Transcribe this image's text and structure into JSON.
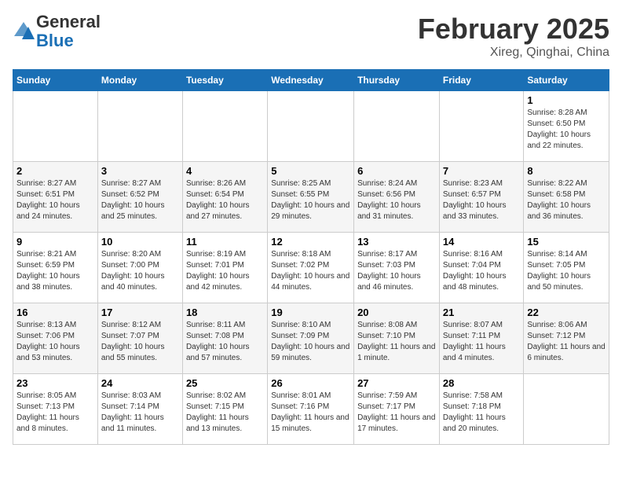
{
  "header": {
    "logo_general": "General",
    "logo_blue": "Blue",
    "month_title": "February 2025",
    "subtitle": "Xireg, Qinghai, China"
  },
  "weekdays": [
    "Sunday",
    "Monday",
    "Tuesday",
    "Wednesday",
    "Thursday",
    "Friday",
    "Saturday"
  ],
  "weeks": [
    [
      {
        "day": "",
        "info": ""
      },
      {
        "day": "",
        "info": ""
      },
      {
        "day": "",
        "info": ""
      },
      {
        "day": "",
        "info": ""
      },
      {
        "day": "",
        "info": ""
      },
      {
        "day": "",
        "info": ""
      },
      {
        "day": "1",
        "info": "Sunrise: 8:28 AM\nSunset: 6:50 PM\nDaylight: 10 hours and 22 minutes."
      }
    ],
    [
      {
        "day": "2",
        "info": "Sunrise: 8:27 AM\nSunset: 6:51 PM\nDaylight: 10 hours and 24 minutes."
      },
      {
        "day": "3",
        "info": "Sunrise: 8:27 AM\nSunset: 6:52 PM\nDaylight: 10 hours and 25 minutes."
      },
      {
        "day": "4",
        "info": "Sunrise: 8:26 AM\nSunset: 6:54 PM\nDaylight: 10 hours and 27 minutes."
      },
      {
        "day": "5",
        "info": "Sunrise: 8:25 AM\nSunset: 6:55 PM\nDaylight: 10 hours and 29 minutes."
      },
      {
        "day": "6",
        "info": "Sunrise: 8:24 AM\nSunset: 6:56 PM\nDaylight: 10 hours and 31 minutes."
      },
      {
        "day": "7",
        "info": "Sunrise: 8:23 AM\nSunset: 6:57 PM\nDaylight: 10 hours and 33 minutes."
      },
      {
        "day": "8",
        "info": "Sunrise: 8:22 AM\nSunset: 6:58 PM\nDaylight: 10 hours and 36 minutes."
      }
    ],
    [
      {
        "day": "9",
        "info": "Sunrise: 8:21 AM\nSunset: 6:59 PM\nDaylight: 10 hours and 38 minutes."
      },
      {
        "day": "10",
        "info": "Sunrise: 8:20 AM\nSunset: 7:00 PM\nDaylight: 10 hours and 40 minutes."
      },
      {
        "day": "11",
        "info": "Sunrise: 8:19 AM\nSunset: 7:01 PM\nDaylight: 10 hours and 42 minutes."
      },
      {
        "day": "12",
        "info": "Sunrise: 8:18 AM\nSunset: 7:02 PM\nDaylight: 10 hours and 44 minutes."
      },
      {
        "day": "13",
        "info": "Sunrise: 8:17 AM\nSunset: 7:03 PM\nDaylight: 10 hours and 46 minutes."
      },
      {
        "day": "14",
        "info": "Sunrise: 8:16 AM\nSunset: 7:04 PM\nDaylight: 10 hours and 48 minutes."
      },
      {
        "day": "15",
        "info": "Sunrise: 8:14 AM\nSunset: 7:05 PM\nDaylight: 10 hours and 50 minutes."
      }
    ],
    [
      {
        "day": "16",
        "info": "Sunrise: 8:13 AM\nSunset: 7:06 PM\nDaylight: 10 hours and 53 minutes."
      },
      {
        "day": "17",
        "info": "Sunrise: 8:12 AM\nSunset: 7:07 PM\nDaylight: 10 hours and 55 minutes."
      },
      {
        "day": "18",
        "info": "Sunrise: 8:11 AM\nSunset: 7:08 PM\nDaylight: 10 hours and 57 minutes."
      },
      {
        "day": "19",
        "info": "Sunrise: 8:10 AM\nSunset: 7:09 PM\nDaylight: 10 hours and 59 minutes."
      },
      {
        "day": "20",
        "info": "Sunrise: 8:08 AM\nSunset: 7:10 PM\nDaylight: 11 hours and 1 minute."
      },
      {
        "day": "21",
        "info": "Sunrise: 8:07 AM\nSunset: 7:11 PM\nDaylight: 11 hours and 4 minutes."
      },
      {
        "day": "22",
        "info": "Sunrise: 8:06 AM\nSunset: 7:12 PM\nDaylight: 11 hours and 6 minutes."
      }
    ],
    [
      {
        "day": "23",
        "info": "Sunrise: 8:05 AM\nSunset: 7:13 PM\nDaylight: 11 hours and 8 minutes."
      },
      {
        "day": "24",
        "info": "Sunrise: 8:03 AM\nSunset: 7:14 PM\nDaylight: 11 hours and 11 minutes."
      },
      {
        "day": "25",
        "info": "Sunrise: 8:02 AM\nSunset: 7:15 PM\nDaylight: 11 hours and 13 minutes."
      },
      {
        "day": "26",
        "info": "Sunrise: 8:01 AM\nSunset: 7:16 PM\nDaylight: 11 hours and 15 minutes."
      },
      {
        "day": "27",
        "info": "Sunrise: 7:59 AM\nSunset: 7:17 PM\nDaylight: 11 hours and 17 minutes."
      },
      {
        "day": "28",
        "info": "Sunrise: 7:58 AM\nSunset: 7:18 PM\nDaylight: 11 hours and 20 minutes."
      },
      {
        "day": "",
        "info": ""
      }
    ]
  ]
}
